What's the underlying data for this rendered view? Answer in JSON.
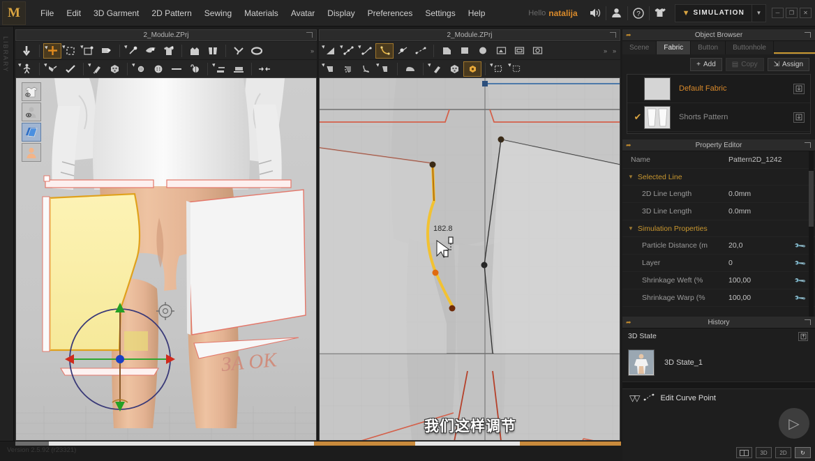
{
  "app": {
    "logo": "M",
    "version_text": "Version 2.5.92   (r23321)"
  },
  "menu": {
    "items": [
      {
        "label": "File"
      },
      {
        "label": "Edit"
      },
      {
        "label": "3D Garment"
      },
      {
        "label": "2D Pattern"
      },
      {
        "label": "Sewing"
      },
      {
        "label": "Materials"
      },
      {
        "label": "Avatar"
      },
      {
        "label": "Display"
      },
      {
        "label": "Preferences"
      },
      {
        "label": "Settings"
      },
      {
        "label": "Help"
      }
    ],
    "hello": "Hello",
    "username": "natalija",
    "icons": [
      "speaker-icon",
      "user-icon",
      "help-icon",
      "garment-icon"
    ],
    "mode_button": "SIMULATION",
    "window_buttons": [
      "minimize",
      "restore",
      "close"
    ]
  },
  "library": {
    "label": "LIBRARY"
  },
  "view3d": {
    "title": "2_Module.ZPrj",
    "side_tools": [
      "garment-visibility-icon",
      "avatar-visibility-icon",
      "pattern-visibility-icon",
      "skin-visibility-icon"
    ],
    "annotation": "ЗАДОК"
  },
  "view2d": {
    "title": "2_Module.ZPrj",
    "measurement": "182.8",
    "subtitle": "我们这样调节"
  },
  "object_browser": {
    "title": "Object Browser",
    "tabs": [
      {
        "label": "Scene",
        "active": false
      },
      {
        "label": "Fabric",
        "active": true
      },
      {
        "label": "Button",
        "active": false
      },
      {
        "label": "Buttonhole",
        "active": false
      }
    ],
    "actions": [
      {
        "label": "Add",
        "icon": "plus-icon",
        "enabled": true
      },
      {
        "label": "Copy",
        "icon": "copy-icon",
        "enabled": false
      },
      {
        "label": "Assign",
        "icon": "assign-icon",
        "enabled": true
      }
    ],
    "items": [
      {
        "name": "Default Fabric",
        "checked": false,
        "highlighted": true
      },
      {
        "name": "Shorts Pattern",
        "checked": true,
        "highlighted": false
      }
    ]
  },
  "property_editor": {
    "title": "Property Editor",
    "name_label": "Name",
    "name_value": "Pattern2D_1242",
    "groups": [
      {
        "title": "Selected Line",
        "rows": [
          {
            "label": "2D Line Length",
            "value": "0.0mm",
            "wrench": false
          },
          {
            "label": "3D Line Length",
            "value": "0.0mm",
            "wrench": false
          }
        ]
      },
      {
        "title": "Simulation Properties",
        "rows": [
          {
            "label": "Particle Distance (m",
            "value": "20,0",
            "wrench": true
          },
          {
            "label": "Layer",
            "value": "0",
            "wrench": true
          },
          {
            "label": "Shrinkage Weft (%",
            "value": "100,00",
            "wrench": true
          },
          {
            "label": "Shrinkage Warp (%",
            "value": "100,00",
            "wrench": true
          }
        ]
      }
    ]
  },
  "history": {
    "title": "History",
    "state_label": "3D State",
    "items": [
      {
        "name": "3D State_1"
      }
    ],
    "edit_label": "Edit Curve Point"
  },
  "view_buttons": [
    {
      "label": "",
      "name": "split-view-button",
      "active": false
    },
    {
      "label": "3D",
      "name": "view-3d-button",
      "active": false
    },
    {
      "label": "2D",
      "name": "view-2d-button",
      "active": false
    },
    {
      "label": "↻",
      "name": "reset-view-button",
      "active": true
    }
  ],
  "colors": {
    "accent": "#d98a2b",
    "gold": "#c9982f",
    "panel_bg": "#1e1e1e",
    "viewport_bg": "#c8c8c8",
    "pattern_select": "#f2e08a",
    "seam_red": "#d4604a"
  }
}
